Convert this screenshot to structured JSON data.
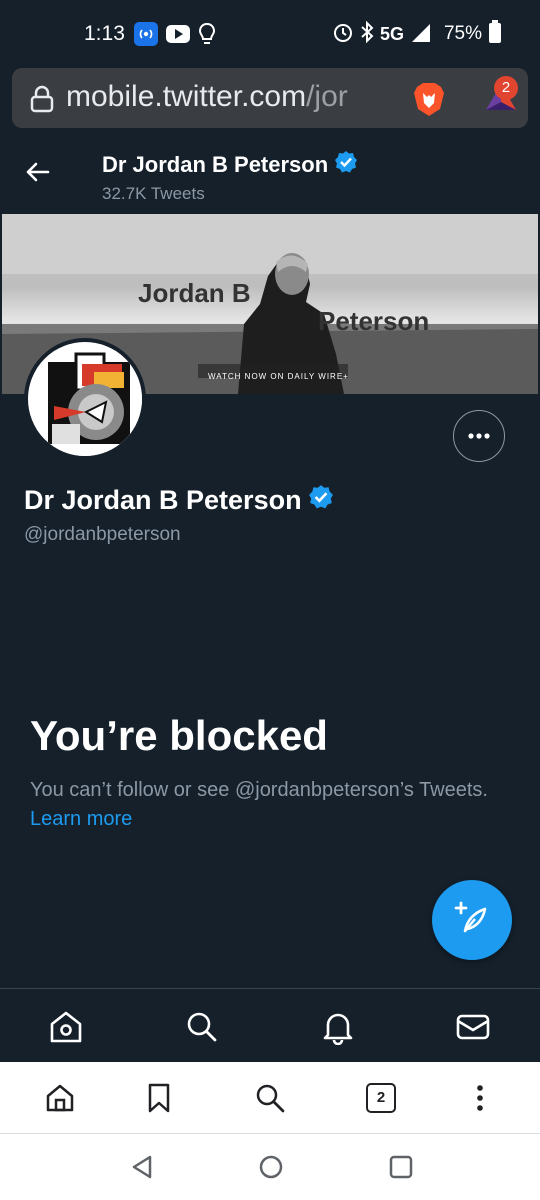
{
  "status_bar": {
    "time": "1:13",
    "network": "5G",
    "battery": "75%",
    "icons": [
      "nfc-icon",
      "youtube-icon",
      "bulb-icon",
      "alarm-icon",
      "bluetooth-icon",
      "signal-icon",
      "battery-icon"
    ]
  },
  "browser": {
    "url_host": "mobile.twitter.com",
    "url_path": "/jor",
    "rewards_badge": "2",
    "tab_count": "2"
  },
  "header": {
    "name": "Dr Jordan B Peterson",
    "tweet_count": "32.7K Tweets"
  },
  "banner": {
    "name_line1": "Jordan B",
    "name_line2": "Peterson",
    "tagline": "WATCH NOW ON DAILY WIRE+"
  },
  "profile": {
    "name": "Dr Jordan B Peterson",
    "handle": "@jordanbpeterson"
  },
  "blocked": {
    "title": "You’re blocked",
    "body": "You can’t follow or see @jordanbpeterson’s Tweets.",
    "link": "Learn more"
  },
  "colors": {
    "background": "#15202b",
    "accent": "#1d9bf0",
    "secondary_text": "#8b98a5",
    "verified": "#1d9bf0"
  }
}
